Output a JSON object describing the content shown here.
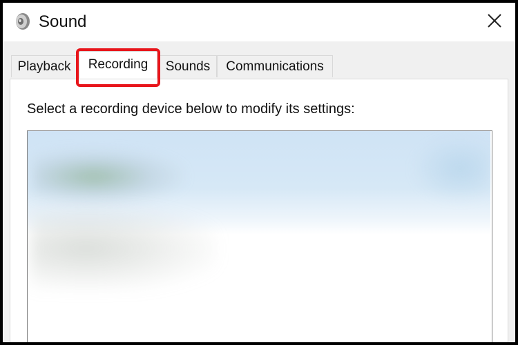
{
  "window": {
    "title": "Sound",
    "app_icon": "speaker-icon",
    "close_icon": "close-icon"
  },
  "tabs": [
    {
      "label": "Playback",
      "active": false
    },
    {
      "label": "Recording",
      "active": true,
      "highlighted": true
    },
    {
      "label": "Sounds",
      "active": false
    },
    {
      "label": "Communications",
      "active": false
    }
  ],
  "recording": {
    "instruction": "Select a recording device below to modify its settings:"
  },
  "colors": {
    "highlight": "#e8151b",
    "tab_border": "#d9d9d9",
    "list_border": "#828282",
    "selection_blur": "#cfe3f5"
  }
}
